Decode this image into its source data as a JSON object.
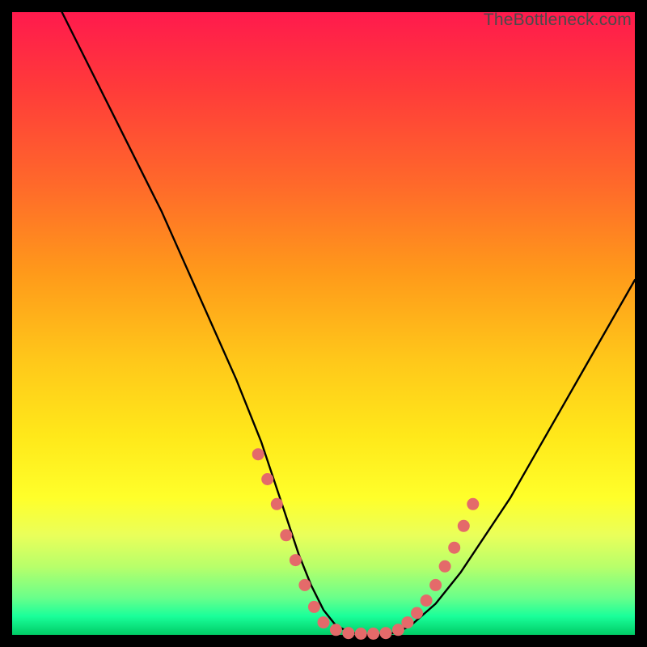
{
  "watermark": "TheBottleneck.com",
  "chart_data": {
    "type": "line",
    "title": "",
    "xlabel": "",
    "ylabel": "",
    "xlim": [
      0,
      100
    ],
    "ylim": [
      0,
      100
    ],
    "series": [
      {
        "name": "bottleneck-curve",
        "x": [
          8,
          12,
          16,
          20,
          24,
          28,
          32,
          36,
          38,
          40,
          42,
          44,
          46,
          48,
          50,
          52,
          54,
          56,
          58,
          60,
          62,
          64,
          68,
          72,
          76,
          80,
          84,
          88,
          92,
          96,
          100
        ],
        "y": [
          100,
          92,
          84,
          76,
          68,
          59,
          50,
          41,
          36,
          31,
          25,
          19,
          13,
          8,
          4,
          1.5,
          0.5,
          0,
          0,
          0,
          0.5,
          1.5,
          5,
          10,
          16,
          22,
          29,
          36,
          43,
          50,
          57
        ]
      }
    ],
    "markers": {
      "name": "scatter-dots",
      "color": "#e46a6a",
      "points": [
        {
          "x": 39.5,
          "y": 29
        },
        {
          "x": 41,
          "y": 25
        },
        {
          "x": 42.5,
          "y": 21
        },
        {
          "x": 44,
          "y": 16
        },
        {
          "x": 45.5,
          "y": 12
        },
        {
          "x": 47,
          "y": 8
        },
        {
          "x": 48.5,
          "y": 4.5
        },
        {
          "x": 50,
          "y": 2
        },
        {
          "x": 52,
          "y": 0.8
        },
        {
          "x": 54,
          "y": 0.3
        },
        {
          "x": 56,
          "y": 0.2
        },
        {
          "x": 58,
          "y": 0.2
        },
        {
          "x": 60,
          "y": 0.3
        },
        {
          "x": 62,
          "y": 0.8
        },
        {
          "x": 63.5,
          "y": 2
        },
        {
          "x": 65,
          "y": 3.5
        },
        {
          "x": 66.5,
          "y": 5.5
        },
        {
          "x": 68,
          "y": 8
        },
        {
          "x": 69.5,
          "y": 11
        },
        {
          "x": 71,
          "y": 14
        },
        {
          "x": 72.5,
          "y": 17.5
        },
        {
          "x": 74,
          "y": 21
        }
      ]
    }
  }
}
